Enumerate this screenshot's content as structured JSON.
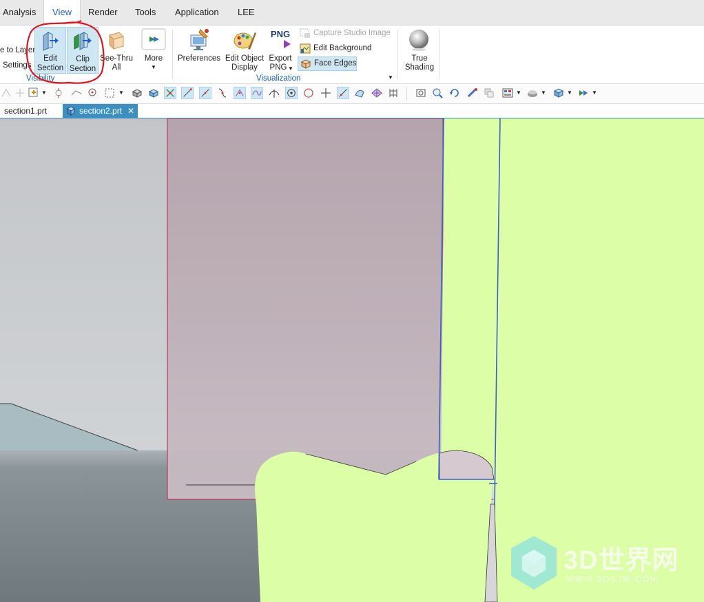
{
  "menu": {
    "items": [
      {
        "label": "Analysis",
        "active": false
      },
      {
        "label": "View",
        "active": true
      },
      {
        "label": "Render",
        "active": false
      },
      {
        "label": "Tools",
        "active": false
      },
      {
        "label": "Application",
        "active": false
      },
      {
        "label": "LEE",
        "active": false
      }
    ]
  },
  "ribbon": {
    "layer_line1": "e to Layer",
    "layer_line2": "Settings",
    "edit_section": [
      "Edit",
      "Section"
    ],
    "clip_section": [
      "Clip",
      "Section"
    ],
    "see_thru": [
      "See-Thru",
      "All"
    ],
    "more": "More",
    "visibility_group": "Visibility",
    "preferences": "Preferences",
    "edit_object_display": [
      "Edit Object",
      "Display"
    ],
    "export_png_icon": "PNG",
    "export_png": [
      "Export",
      "PNG"
    ],
    "capture_studio_image": "Capture Studio Image",
    "edit_background": "Edit Background",
    "face_edges": "Face Edges",
    "visualization_group": "Visualization",
    "true_shading": [
      "True",
      "Shading"
    ]
  },
  "tabs": [
    {
      "label": "section1.prt",
      "active": false
    },
    {
      "label": "section2.prt",
      "active": true
    }
  ],
  "watermark": {
    "main": "3D世界网",
    "sub": "WWW.3DSJW.COM"
  },
  "colors": {
    "accent": "#1a63c6",
    "tab_active": "#3d8fbf",
    "ribbon_group": "#1b5fa8",
    "section_fill": "#dbfea6",
    "annotation_red": "#e0141e"
  }
}
